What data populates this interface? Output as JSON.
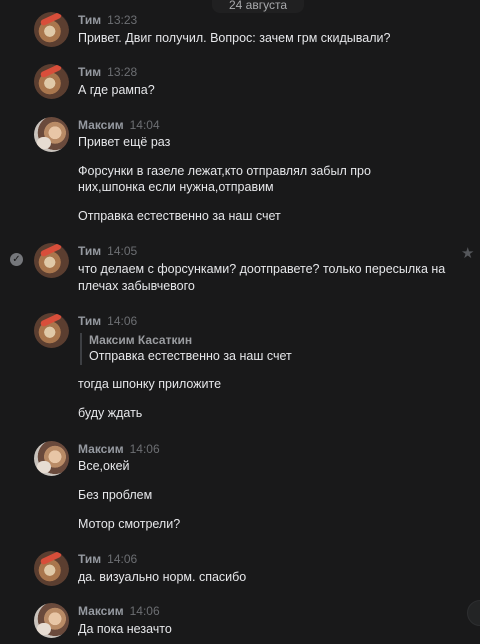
{
  "date_separator": "24 августа",
  "messages": [
    {
      "author": "Тим",
      "time": "13:23",
      "lines": [
        "Привет. Двиг получил. Вопрос: зачем грм скидывали?"
      ]
    },
    {
      "author": "Тим",
      "time": "13:28",
      "lines": [
        "А где рампа?"
      ]
    },
    {
      "author": "Максим",
      "time": "14:04",
      "lines": [
        "Привет ещё раз",
        "Форсунки в газеле лежат,кто отправлял забыл про",
        "них,шпонка если нужна,отправим",
        "Отправка естественно за наш счет"
      ]
    },
    {
      "author": "Тим",
      "time": "14:05",
      "lines": [
        "что делаем с форсунками? доотправете? только пересылка на",
        "плечах забывчевого"
      ]
    },
    {
      "author": "Тим",
      "time": "14:06",
      "quote": {
        "author": "Максим Касаткин",
        "text": "Отправка естественно за наш счет"
      },
      "lines": [
        "тогда шпонку приложите",
        "буду ждать"
      ]
    },
    {
      "author": "Максим",
      "time": "14:06",
      "lines": [
        "Все,окей",
        "Без проблем",
        "Мотор смотрели?"
      ]
    },
    {
      "author": "Тим",
      "time": "14:06",
      "lines": [
        "да. визуально норм. спасибо"
      ]
    },
    {
      "author": "Максим",
      "time": "14:06",
      "lines": [
        "Да пока незачто"
      ]
    }
  ],
  "icons": {
    "check": "check-circle-icon",
    "star": "star-icon"
  },
  "colors": {
    "background": "#19191a",
    "author": "#9599a0",
    "time": "#6c6e72",
    "text": "#e6e7ea"
  }
}
